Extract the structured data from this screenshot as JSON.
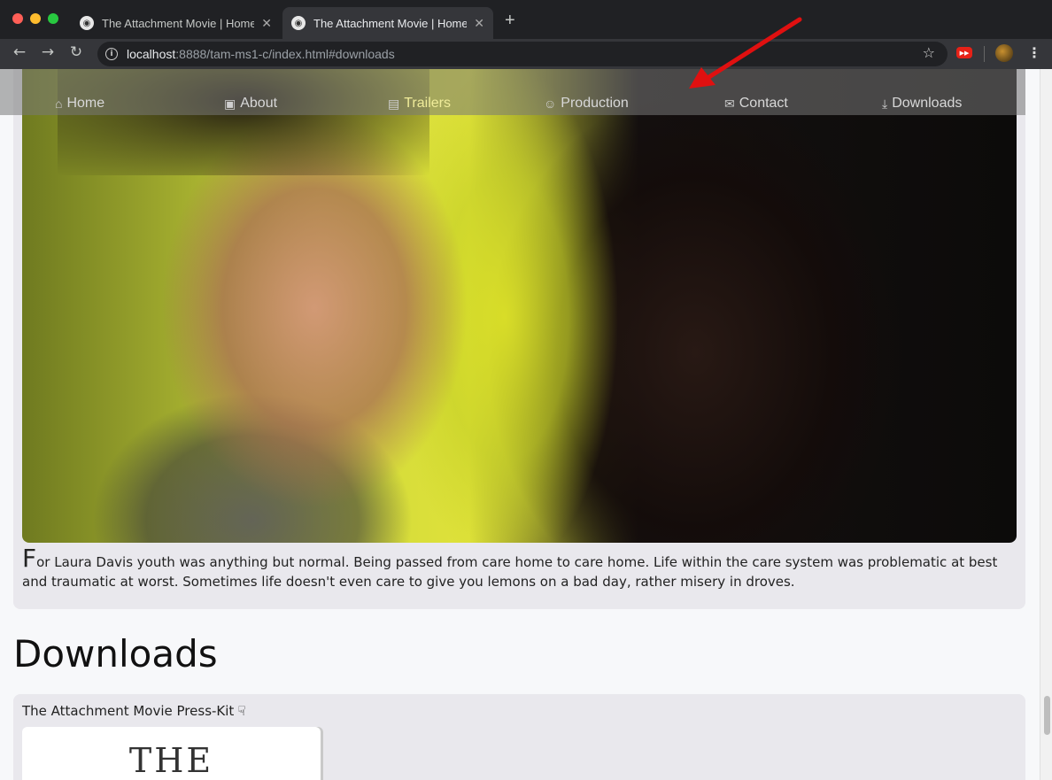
{
  "browser": {
    "tabs": [
      {
        "title": "The Attachment Movie | Homepage",
        "active": false
      },
      {
        "title": "The Attachment Movie | Homepage",
        "active": true
      }
    ],
    "url_host": "localhost",
    "url_rest": ":8888/tam-ms1-c/index.html#downloads"
  },
  "site_nav": {
    "items": [
      {
        "label": "Home",
        "icon": "home-icon"
      },
      {
        "label": "About",
        "icon": "cubes-icon"
      },
      {
        "label": "Trailers",
        "icon": "film-icon"
      },
      {
        "label": "Production",
        "icon": "masks-icon"
      },
      {
        "label": "Contact",
        "icon": "envelope-icon"
      },
      {
        "label": "Downloads",
        "icon": "download-icon"
      }
    ],
    "active": "Trailers"
  },
  "intro": {
    "dropcap": "F",
    "text": "or Laura Davis youth was anything but normal. Being passed from care home to care home. Life within the care system was problematic at best and traumatic at worst. Sometimes life doesn't even care to give you lemons on a bad day, rather misery in droves."
  },
  "downloads": {
    "heading": "Downloads",
    "item_label": "The Attachment Movie Press-Kit",
    "cover_text": "THE"
  },
  "colors": {
    "accent_active_nav": "#f0ec9a",
    "annotation_arrow": "#e01010"
  }
}
